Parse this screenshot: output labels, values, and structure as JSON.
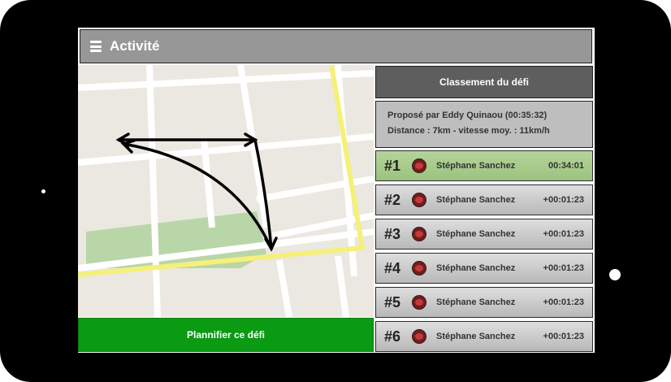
{
  "app": {
    "title": "Activité"
  },
  "map": {
    "colors": {
      "land": "#ebe8e1",
      "road": "#ffffff",
      "highlight_road": "#f6f07a",
      "park": "#b9d6a8"
    }
  },
  "actions": {
    "plan_label": "Plannifier ce défi"
  },
  "ranking": {
    "title": "Classement du défi",
    "proposed_by": "Proposé par Eddy Quinaou (00:35:32)",
    "distance_line": "Distance : 7km - vitesse moy. : 11km/h",
    "entries": [
      {
        "rank": "#1",
        "name": "Stéphane Sanchez",
        "time": "00:34:01"
      },
      {
        "rank": "#2",
        "name": "Stéphane Sanchez",
        "time": "+00:01:23"
      },
      {
        "rank": "#3",
        "name": "Stéphane Sanchez",
        "time": "+00:01:23"
      },
      {
        "rank": "#4",
        "name": "Stéphane Sanchez",
        "time": "+00:01:23"
      },
      {
        "rank": "#5",
        "name": "Stéphane Sanchez",
        "time": "+00:01:23"
      },
      {
        "rank": "#6",
        "name": "Stéphane Sanchez",
        "time": "+00:01:23"
      }
    ]
  }
}
